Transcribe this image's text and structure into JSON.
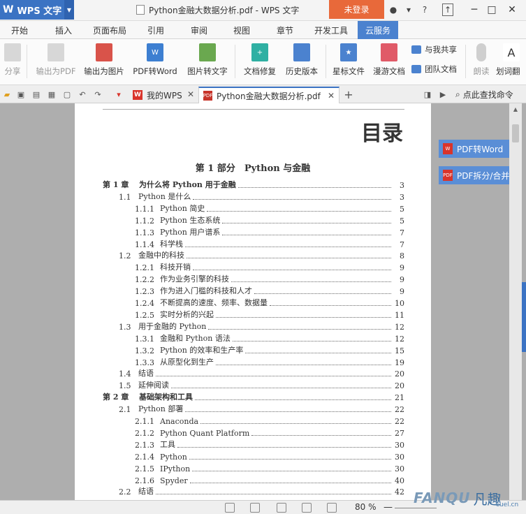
{
  "titlebar": {
    "app_name": "WPS 文字",
    "document_title": "Python金融大数据分析.pdf - WPS 文字",
    "login_label": "未登录",
    "help_label": "?"
  },
  "ribbon_tabs": [
    "开始",
    "插入",
    "页面布局",
    "引用",
    "审阅",
    "视图",
    "章节",
    "开发工具",
    "云服务"
  ],
  "ribbon_active_tab": "云服务",
  "ribbon": {
    "buttons": [
      {
        "label": "分享",
        "icon": "share-icon",
        "disabled": true
      },
      {
        "label": "输出为PDF",
        "icon": "export-pdf-icon",
        "disabled": true
      },
      {
        "label": "输出为图片",
        "icon": "export-image-icon",
        "disabled": false
      },
      {
        "label": "PDF转Word",
        "icon": "pdf-to-word-icon",
        "disabled": false
      },
      {
        "label": "图片转文字",
        "icon": "image-to-text-icon",
        "disabled": false
      },
      {
        "label": "文档修复",
        "icon": "document-repair-icon",
        "disabled": false
      },
      {
        "label": "历史版本",
        "icon": "history-version-icon",
        "disabled": false
      },
      {
        "label": "星标文件",
        "icon": "starred-files-icon",
        "disabled": false
      },
      {
        "label": "漫游文档",
        "icon": "roaming-docs-icon",
        "disabled": false
      },
      {
        "label": "朗读",
        "icon": "microphone-icon",
        "disabled": true
      },
      {
        "label": "划词翻",
        "icon": "translate-icon",
        "disabled": false
      }
    ],
    "small_buttons": [
      {
        "label": "与我共享",
        "icon": "shared-with-me-icon"
      },
      {
        "label": "团队文档",
        "icon": "team-docs-icon"
      }
    ]
  },
  "doc_tabs": [
    {
      "label": "我的WPS",
      "icon": "wps-logo-icon"
    },
    {
      "label": "Python金融大数据分析.pdf",
      "icon": "pdf-file-icon",
      "active": true
    }
  ],
  "find_command": "点此查找命令",
  "document": {
    "heading": "目录",
    "part_title": "第 1 部分　Python 与金融",
    "toc": [
      {
        "num": "第 1 章",
        "title": "为什么将 Python 用于金融",
        "page": "3",
        "level": 0
      },
      {
        "num": "1.1",
        "title": "Python 是什么",
        "page": "3",
        "level": 1
      },
      {
        "num": "1.1.1",
        "title": "Python 简史",
        "page": "5",
        "level": 2
      },
      {
        "num": "1.1.2",
        "title": "Python 生态系统",
        "page": "5",
        "level": 2
      },
      {
        "num": "1.1.3",
        "title": "Python 用户谱系",
        "page": "7",
        "level": 2
      },
      {
        "num": "1.1.4",
        "title": "科学栈",
        "page": "7",
        "level": 2
      },
      {
        "num": "1.2",
        "title": "金融中的科技",
        "page": "8",
        "level": 1
      },
      {
        "num": "1.2.1",
        "title": "科技开销",
        "page": "9",
        "level": 2
      },
      {
        "num": "1.2.2",
        "title": "作为业务引擎的科技",
        "page": "9",
        "level": 2
      },
      {
        "num": "1.2.3",
        "title": "作为进入门槛的科技和人才",
        "page": "9",
        "level": 2
      },
      {
        "num": "1.2.4",
        "title": "不断提高的速度、频率、数据量",
        "page": "10",
        "level": 2
      },
      {
        "num": "1.2.5",
        "title": "实时分析的兴起",
        "page": "11",
        "level": 2
      },
      {
        "num": "1.3",
        "title": "用于金融的 Python",
        "page": "12",
        "level": 1
      },
      {
        "num": "1.3.1",
        "title": "金融和 Python 语法",
        "page": "12",
        "level": 2
      },
      {
        "num": "1.3.2",
        "title": "Python 的效率和生产率",
        "page": "15",
        "level": 2
      },
      {
        "num": "1.3.3",
        "title": "从原型化到生产",
        "page": "19",
        "level": 2
      },
      {
        "num": "1.4",
        "title": "结语",
        "page": "20",
        "level": 1
      },
      {
        "num": "1.5",
        "title": "延伸阅读",
        "page": "20",
        "level": 1
      },
      {
        "num": "第 2 章",
        "title": "基础架构和工具",
        "page": "21",
        "level": 0
      },
      {
        "num": "2.1",
        "title": "Python 部署",
        "page": "22",
        "level": 1
      },
      {
        "num": "2.1.1",
        "title": "Anaconda",
        "page": "22",
        "level": 2
      },
      {
        "num": "2.1.2",
        "title": "Python Quant Platform",
        "page": "27",
        "level": 2
      },
      {
        "num": "2.1.3",
        "title": "工具",
        "page": "30",
        "level": 2
      },
      {
        "num": "2.1.4",
        "title": "Python",
        "page": "30",
        "level": 2
      },
      {
        "num": "2.1.5",
        "title": "IPython",
        "page": "30",
        "level": 2
      },
      {
        "num": "2.1.6",
        "title": "Spyder",
        "page": "40",
        "level": 2
      },
      {
        "num": "2.2",
        "title": "结语",
        "page": "42",
        "level": 1
      }
    ]
  },
  "side_panel": [
    {
      "label": "PDF转Word",
      "icon": "pdf-to-word-icon"
    },
    {
      "label": "PDF拆分/合并",
      "icon": "pdf-split-merge-icon"
    }
  ],
  "statusbar": {
    "zoom": "80 %",
    "zoom_minus": "—"
  },
  "watermark": {
    "latin": "FANQU",
    "cjk": "凡趣",
    "domain": "cuel.cn"
  },
  "colors": {
    "accent": "#3b73c3",
    "login": "#e8693a",
    "side_button": "#5a8ed6"
  }
}
